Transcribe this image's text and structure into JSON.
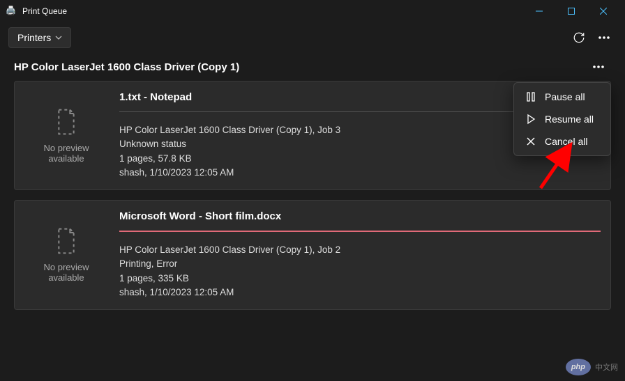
{
  "titlebar": {
    "title": "Print Queue"
  },
  "toolbar": {
    "printers_label": "Printers"
  },
  "printer": {
    "name": "HP Color LaserJet 1600 Class Driver (Copy 1)"
  },
  "preview": {
    "label1": "No preview",
    "label2": "available"
  },
  "jobs": [
    {
      "title": "1.txt - Notepad",
      "l1": "HP Color LaserJet 1600 Class Driver (Copy 1), Job 3",
      "l2": "Unknown status",
      "l3": "1 pages, 57.8 KB",
      "l4": "shash, 1/10/2023 12:05 AM",
      "error": false
    },
    {
      "title": "Microsoft Word - Short film.docx",
      "l1": "HP Color LaserJet 1600 Class Driver (Copy 1), Job 2",
      "l2": "Printing, Error",
      "l3": "1 pages, 335 KB",
      "l4": "shash, 1/10/2023 12:05 AM",
      "error": true
    }
  ],
  "menu": {
    "pause": "Pause all",
    "resume": "Resume all",
    "cancel": "Cancel all"
  },
  "watermark": {
    "badge": "php",
    "text": "中文网"
  }
}
